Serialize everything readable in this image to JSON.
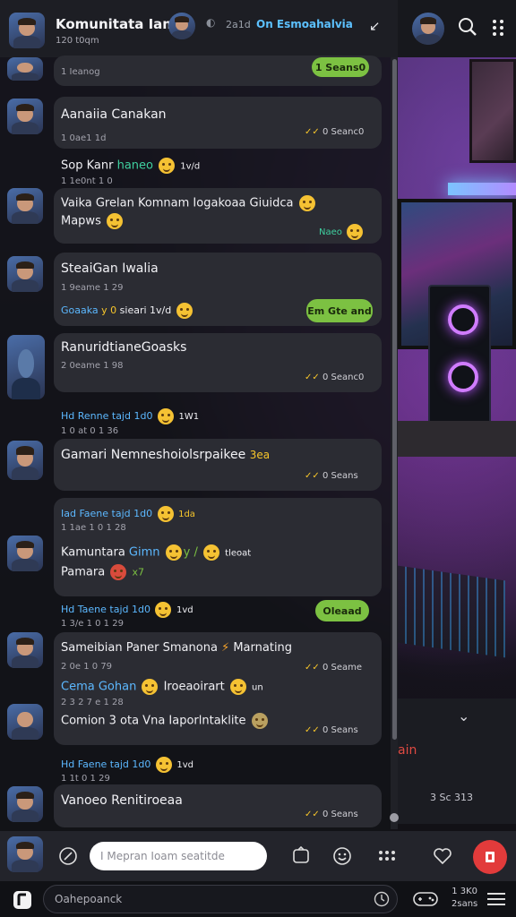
{
  "header": {
    "title": "Komunitata Iamir",
    "subtitle": "120 t0qm",
    "meta": "2a1d",
    "link": "On Esmoahalvia"
  },
  "messages": [
    {
      "time": "1 Ieanog",
      "status": "1 Seans0"
    },
    {
      "name": "Aanaiia Canakan",
      "time": "1 0ae1 1d",
      "status": "0 Seanc0"
    },
    {
      "line1_pre": "Sop Kanr",
      "line1_hl": "haneo",
      "line1_post": "1v/d",
      "line1_time": "1 1e0nt 1 0",
      "line2": "Vaika Grelan Komnam Iogakoaa Giuidca",
      "line3": "Mapws",
      "status": "Naeo"
    },
    {
      "name": "SteaiGan Iwalia",
      "time": "1 9eame 1 29",
      "sub_hl": "Goaaka",
      "sub_mid": "y 0 ",
      "sub_post": "sieari 1v/d",
      "pill": "Em Gte and"
    },
    {
      "name": "RanuridtianeGoasks",
      "time": "2 0eame 1 98",
      "status": "0 Seanc0"
    },
    {
      "pre_hl": "Hd Renne tajd 1d0",
      "pre_tail": "1W1",
      "name": "Gamari Nemneshoiolsrpaikee",
      "name_hl": "3ea",
      "time": "1 0 at 0 1 36",
      "status": "0 Seans"
    },
    {
      "pre_hl": "Iad Faene tajd 1d0",
      "pre_tail": "1da",
      "time_pre": "1 1ae 1 0 1 28",
      "name": "Kamuntara",
      "name_hl": "Gimn",
      "name_mid": "y /",
      "tail": "tleoat",
      "line2": "Pamara",
      "line2_hl": "x7",
      "pill": "Oleaad"
    },
    {
      "pre_hl": "Hd Taene tajd 1d0",
      "pre_tail": "1vd",
      "time_pre": "1 3/e 1 0 1 29",
      "name": "Sameibian Paner Smanona",
      "name_post": "Marnating",
      "time": "2 0e 1 0 79",
      "line2_hl": "Cema Gohan",
      "line2_post": "Iroeaoirart",
      "line2_tail": "un",
      "line2_time": "2 3 2 7 e 1 28",
      "line3": "Comion 3 ota Vna Iaporlntaklite",
      "status1": "0 Seame",
      "status2": "0 Seans"
    },
    {
      "pre_hl": "Hd Faene tajd 1d0",
      "pre_tail": "1vd",
      "time_pre": "1 1t 0 1 29",
      "name": "Vanoeo Renitiroeaa",
      "status": "0 Seans"
    }
  ],
  "composer": {
    "placeholder": "I Mepran Ioam seatitde"
  },
  "right_panel": {
    "tail": "ain",
    "time": "3 Sc 313"
  },
  "bottom": {
    "search": "Oahepoanck",
    "meta1": "1 3K0",
    "meta2": "2sans"
  }
}
